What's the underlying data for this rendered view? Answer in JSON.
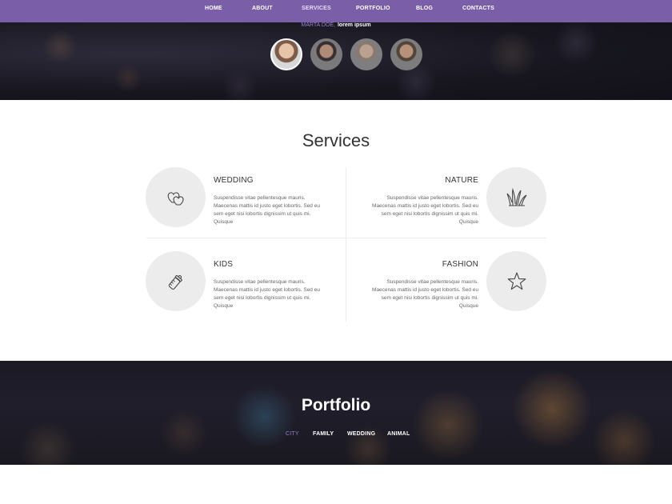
{
  "nav": {
    "items": [
      {
        "label": "HOME"
      },
      {
        "label": "ABOUT"
      },
      {
        "label": "SERVICES"
      },
      {
        "label": "PORTFOLIO"
      },
      {
        "label": "BLOG"
      },
      {
        "label": "CONTACTS"
      }
    ],
    "active": "SERVICES"
  },
  "hero": {
    "author": "MARTA DOE,",
    "text": "lorem ipsum"
  },
  "services": {
    "title": "Services",
    "items": [
      {
        "title": "WEDDING",
        "icon": "hearts-icon",
        "description": "Suspendisse vitae pellentesque mauris. Maecenas mattis id justo eget lobortis. Sed eu sem eget nisi lobortis dignissim ut quis mi. Quisque"
      },
      {
        "title": "NATURE",
        "icon": "grass-icon",
        "description": "Suspendisse vitae pellentesque mauris. Maecenas mattis id justo eget lobortis. Sed eu sem eget nisi lobortis dignissim ut quis mi. Quisque"
      },
      {
        "title": "KIDS",
        "icon": "baby-bottle-icon",
        "description": "Suspendisse vitae pellentesque mauris. Maecenas mattis id justo eget lobortis. Sed eu sem eget nisi lobortis dignissim ut quis mi. Quisque"
      },
      {
        "title": "FASHION",
        "icon": "star-icon",
        "description": "Suspendisse vitae pellentesque mauris. Maecenas mattis id justo eget lobortis. Sed eu sem eget nisi lobortis dignissim ut quis mi. Quisque"
      }
    ]
  },
  "portfolio": {
    "title": "Portfolio",
    "filters": [
      {
        "label": "CITY"
      },
      {
        "label": "FAMILY"
      },
      {
        "label": "WEDDING"
      },
      {
        "label": "ANIMAL"
      }
    ],
    "active_filter": "CITY"
  },
  "colors": {
    "accent": "#7a5fa8",
    "accent_light": "#9b7fd0",
    "circle_bg": "#ececec"
  }
}
